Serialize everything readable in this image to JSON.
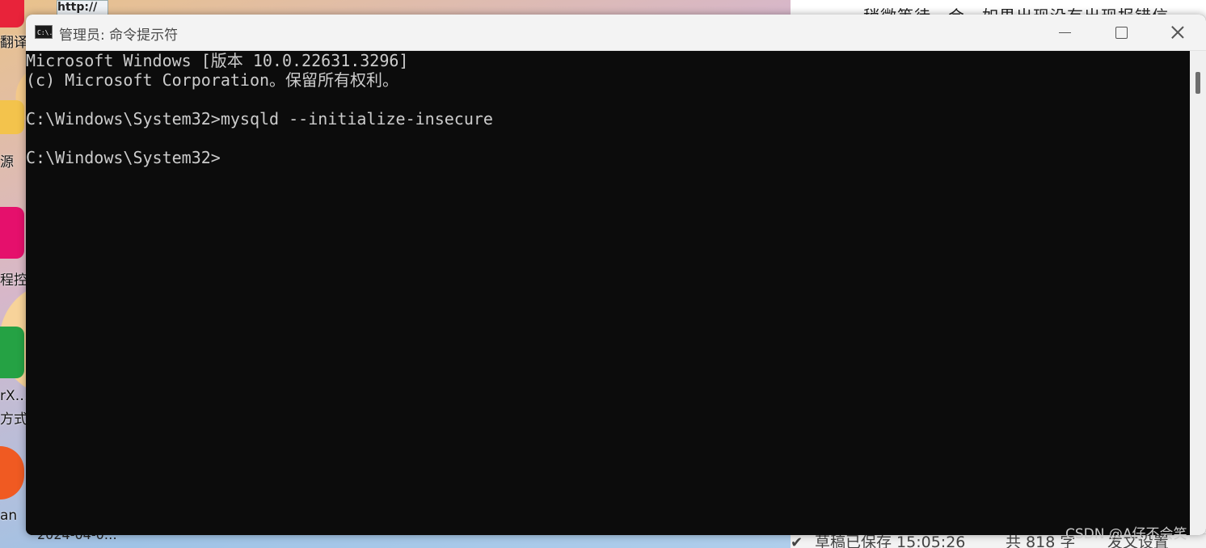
{
  "desktop": {
    "labels": [
      "翻译",
      "源",
      "程控",
      "rX…",
      "方式",
      "an"
    ],
    "browser_thumb": "http://",
    "bottom_text": "2024-04-0…"
  },
  "editor": {
    "top_text": "稍微等待一会，如果出现没有出现报错信",
    "status": {
      "saved": "草稿已保存 15:05:26",
      "count": "共 818 字",
      "publish": "发文设置"
    }
  },
  "window": {
    "title": "管理员: 命令提示符",
    "icon_text": "C:\\."
  },
  "console": {
    "lines": [
      "Microsoft Windows [版本 10.0.22631.3296]",
      "(c) Microsoft Corporation。保留所有权利。",
      "",
      "C:\\Windows\\System32>mysqld --initialize-insecure",
      "",
      "C:\\Windows\\System32>"
    ]
  },
  "watermark": "CSDN @A仔不会笑",
  "colors": {
    "console_bg": "#0c0c0c",
    "console_fg": "#cccccc",
    "titlebar_bg": "#f3f3f3"
  }
}
